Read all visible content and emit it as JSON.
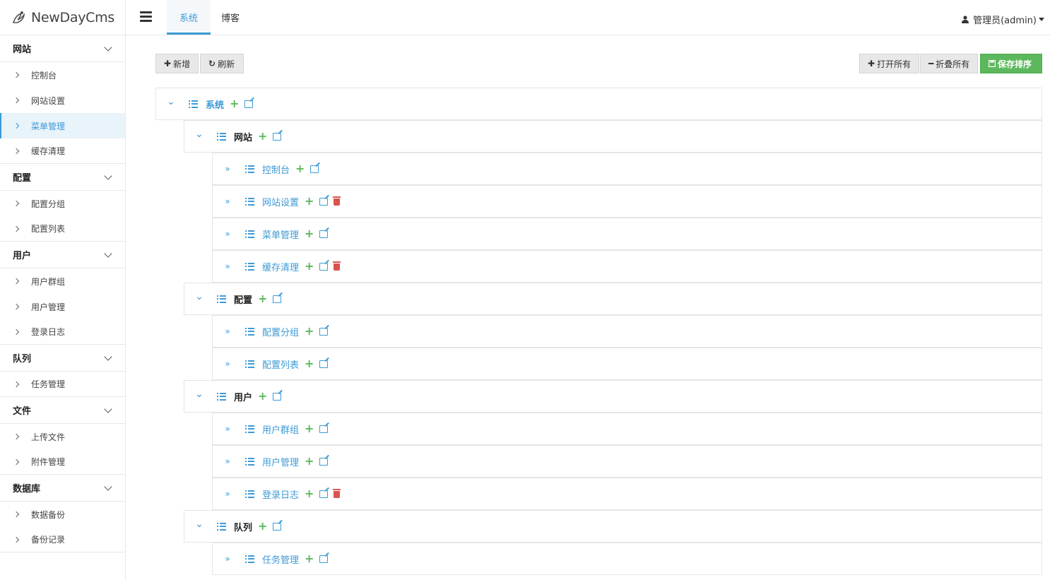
{
  "app": {
    "logo_text": "NewDayCms"
  },
  "header": {
    "tabs": [
      {
        "label": "系统"
      },
      {
        "label": "博客"
      }
    ],
    "user_label": "管理员(admin)"
  },
  "sidebar": {
    "groups": [
      {
        "title": "网站",
        "items": [
          "控制台",
          "网站设置",
          "菜单管理",
          "缓存清理"
        ]
      },
      {
        "title": "配置",
        "items": [
          "配置分组",
          "配置列表"
        ]
      },
      {
        "title": "用户",
        "items": [
          "用户群组",
          "用户管理",
          "登录日志"
        ]
      },
      {
        "title": "队列",
        "items": [
          "任务管理"
        ]
      },
      {
        "title": "文件",
        "items": [
          "上传文件",
          "附件管理"
        ]
      },
      {
        "title": "数据库",
        "items": [
          "数据备份",
          "备份记录"
        ]
      }
    ],
    "active_item": "菜单管理"
  },
  "toolbar": {
    "add_label": "新增",
    "refresh_label": "刷新",
    "expand_all_label": "打开所有",
    "collapse_all_label": "折叠所有",
    "save_order_label": "保存排序"
  },
  "tree": [
    {
      "label": "系统",
      "level": 0,
      "deletable": false
    },
    {
      "label": "网站",
      "level": 1,
      "deletable": false
    },
    {
      "label": "控制台",
      "level": 2,
      "deletable": false
    },
    {
      "label": "网站设置",
      "level": 2,
      "deletable": true
    },
    {
      "label": "菜单管理",
      "level": 2,
      "deletable": false
    },
    {
      "label": "缓存清理",
      "level": 2,
      "deletable": true
    },
    {
      "label": "配置",
      "level": 1,
      "deletable": false
    },
    {
      "label": "配置分组",
      "level": 2,
      "deletable": false
    },
    {
      "label": "配置列表",
      "level": 2,
      "deletable": false
    },
    {
      "label": "用户",
      "level": 1,
      "deletable": false
    },
    {
      "label": "用户群组",
      "level": 2,
      "deletable": false
    },
    {
      "label": "用户管理",
      "level": 2,
      "deletable": false
    },
    {
      "label": "登录日志",
      "level": 2,
      "deletable": true
    },
    {
      "label": "队列",
      "level": 1,
      "deletable": false
    },
    {
      "label": "任务管理",
      "level": 2,
      "deletable": false
    }
  ],
  "colors": {
    "accent": "#3c9ad6",
    "add": "#5cb85c",
    "delete": "#d9534f",
    "save": "#5cb85c"
  }
}
